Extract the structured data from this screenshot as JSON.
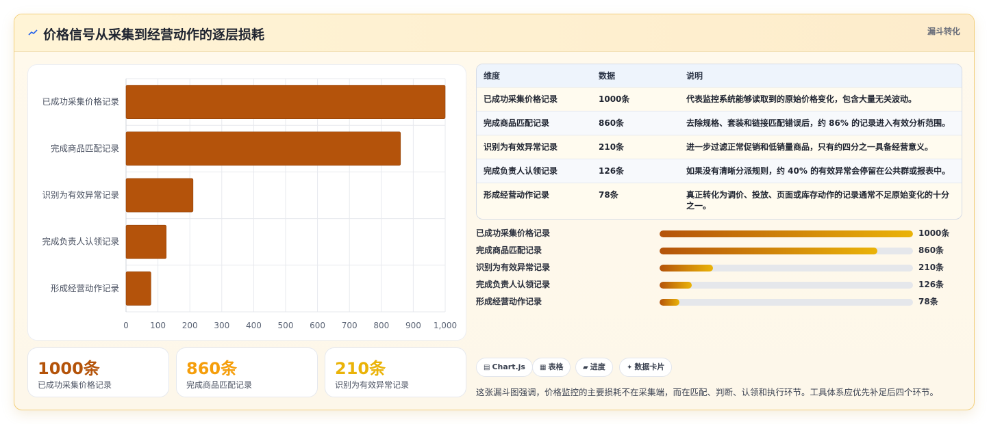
{
  "header": {
    "title": "价格信号从采集到经营动作的逐层损耗",
    "tag": "漏斗转化",
    "icon": "trend-icon"
  },
  "chart_data": {
    "type": "bar",
    "orientation": "horizontal",
    "categories": [
      "已成功采集价格记录",
      "完成商品匹配记录",
      "识别为有效异常记录",
      "完成负责人认领记录",
      "形成经营动作记录"
    ],
    "values": [
      1000,
      860,
      210,
      126,
      78
    ],
    "xlim": [
      0,
      1000
    ],
    "x_ticks": [
      "0",
      "100",
      "200",
      "300",
      "400",
      "500",
      "600",
      "700",
      "800",
      "900",
      "1,000"
    ],
    "title": "",
    "xlabel": "",
    "ylabel": "",
    "grid": true,
    "bar_color": "#b4530b"
  },
  "kpis": [
    {
      "value": "1000条",
      "label": "已成功采集价格记录",
      "color": "#b45309"
    },
    {
      "value": "860条",
      "label": "完成商品匹配记录",
      "color": "#f59e0b"
    },
    {
      "value": "210条",
      "label": "识别为有效异常记录",
      "color": "#eab308"
    }
  ],
  "table": {
    "headers": [
      "维度",
      "数据",
      "说明"
    ],
    "rows": [
      {
        "dim": "已成功采集价格记录",
        "data": "1000条",
        "desc": "代表监控系统能够读取到的原始价格变化，包含大量无关波动。"
      },
      {
        "dim": "完成商品匹配记录",
        "data": "860条",
        "desc": "去除规格、套装和链接匹配错误后，约 86% 的记录进入有效分析范围。"
      },
      {
        "dim": "识别为有效异常记录",
        "data": "210条",
        "desc": "进一步过滤正常促销和低销量商品，只有约四分之一具备经营意义。"
      },
      {
        "dim": "完成负责人认领记录",
        "data": "126条",
        "desc": "如果没有清晰分派规则，约 40% 的有效异常会停留在公共群或报表中。"
      },
      {
        "dim": "形成经营动作记录",
        "data": "78条",
        "desc": "真正转化为调价、投放、页面或库存动作的记录通常不足原始变化的十分之一。"
      }
    ]
  },
  "progress": {
    "max": 1000,
    "items": [
      {
        "label": "已成功采集价格记录",
        "value": 1000,
        "value_text": "1000条"
      },
      {
        "label": "完成商品匹配记录",
        "value": 860,
        "value_text": "860条"
      },
      {
        "label": "识别为有效异常记录",
        "value": 210,
        "value_text": "210条"
      },
      {
        "label": "完成负责人认领记录",
        "value": 126,
        "value_text": "126条"
      },
      {
        "label": "形成经营动作记录",
        "value": 78,
        "value_text": "78条"
      }
    ]
  },
  "chips": [
    {
      "label": "Chart.js",
      "icon": "chart-icon"
    },
    {
      "label": "表格",
      "icon": "table-icon"
    },
    {
      "label": "进度",
      "icon": "progress-icon"
    },
    {
      "label": "数据卡片",
      "icon": "sparkle-icon"
    }
  ],
  "footnote": "这张漏斗图强调，价格监控的主要损耗不在采集端，而在匹配、判断、认领和执行环节。工具体系应优先补足后四个环节。"
}
